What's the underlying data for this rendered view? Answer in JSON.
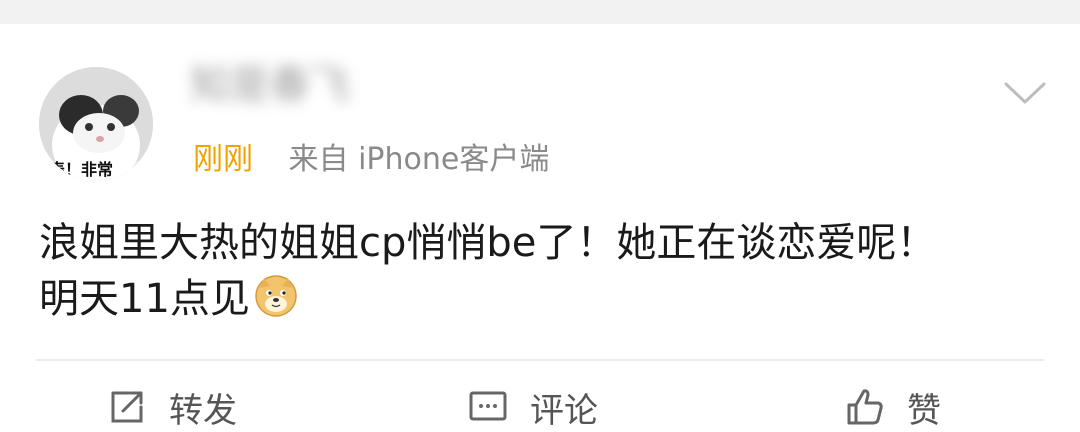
{
  "post": {
    "username": "知是春飞",
    "time": "刚刚",
    "source": "来自 iPhone客户端",
    "avatar_caption": "表！非常"
  },
  "content": {
    "line1": "浪姐里大热的姐姐cp悄悄be了！她正在谈恋爱呢！",
    "line2": "明天11点见"
  },
  "actions": {
    "repost_label": "转发",
    "comment_label": "评论",
    "like_label": "赞"
  },
  "icons": {
    "menu": "chevron-down-icon",
    "repost": "share-icon",
    "comment": "comment-icon",
    "like": "thumbs-up-icon",
    "emoji": "doge-emoji-icon"
  },
  "colors": {
    "time": "#f0a200",
    "source": "#8a8a8a",
    "text": "#1a1a1a",
    "divider": "#ececec"
  }
}
